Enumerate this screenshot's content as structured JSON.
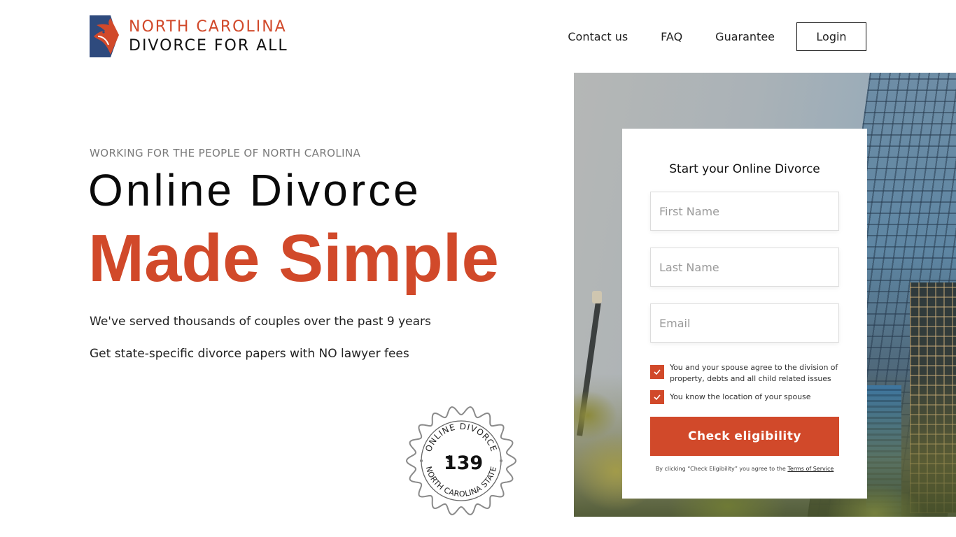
{
  "brand": {
    "line1": "NORTH CAROLINA",
    "line2": "DIVORCE FOR ALL",
    "colors": {
      "accent": "#d1492a",
      "navy": "#2e4a7d",
      "text": "#111111"
    }
  },
  "nav": {
    "links": [
      "Contact us",
      "FAQ",
      "Guarantee"
    ],
    "login_label": "Login"
  },
  "hero": {
    "kicker": "WORKING FOR THE PEOPLE OF NORTH CAROLINA",
    "title_line1": "Online Divorce",
    "title_line2": "Made Simple",
    "paragraphs": [
      "We've served thousands of couples over the past 9 years",
      "Get state-specific divorce papers with NO lawyer fees"
    ]
  },
  "badge": {
    "top_arc": "ONLINE DIVORCE",
    "bottom_arc": "NORTH CAROLINA STATE",
    "currency": "$",
    "price": "139"
  },
  "form": {
    "title": "Start your Online Divorce",
    "fields": [
      {
        "name": "first-name",
        "placeholder": "First Name",
        "value": ""
      },
      {
        "name": "last-name",
        "placeholder": "Last Name",
        "value": ""
      },
      {
        "name": "email",
        "placeholder": "Email",
        "value": ""
      }
    ],
    "checkboxes": [
      {
        "label": "You and your spouse agree to the division of property, debts and all child related issues",
        "checked": true
      },
      {
        "label": "You know the location of your spouse",
        "checked": true
      }
    ],
    "submit_label": "Check eligibility",
    "legal_prefix": "By clicking “Check Eligibility” you agree to the ",
    "legal_link": "Terms of Service"
  }
}
